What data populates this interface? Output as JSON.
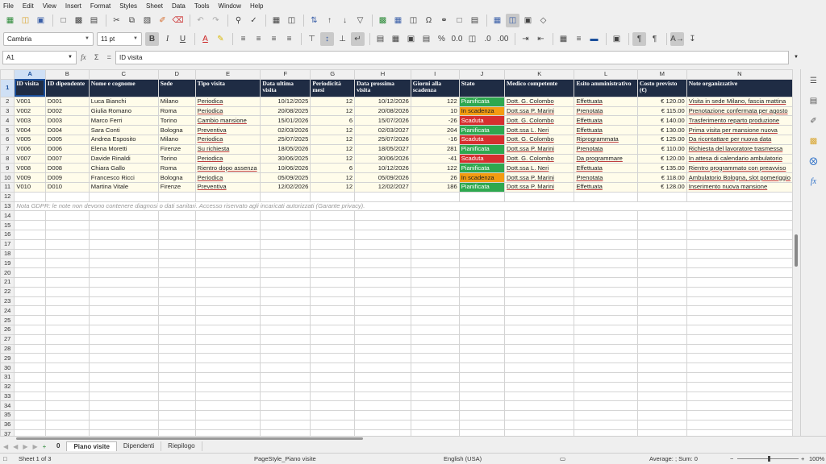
{
  "menu": [
    "File",
    "Edit",
    "View",
    "Insert",
    "Format",
    "Styles",
    "Sheet",
    "Data",
    "Tools",
    "Window",
    "Help"
  ],
  "format": {
    "font_name": "Cambria",
    "font_size": "11 pt"
  },
  "formula": {
    "cell_ref": "A1",
    "content": "ID visita"
  },
  "columns": [
    "A",
    "B",
    "C",
    "D",
    "E",
    "F",
    "G",
    "H",
    "I",
    "J",
    "K",
    "L",
    "M",
    "N"
  ],
  "header": [
    "ID visita",
    "ID dipendente",
    "Nome e cognome",
    "Sede",
    "Tipo visita",
    "Data ultima visita",
    "Periodicità mesi",
    "Data prossima visita",
    "Giorni alla scadenza",
    "Stato",
    "Medico competente",
    "Esito amministrativo",
    "Costo previsto (€)",
    "Note organizzative"
  ],
  "rows": [
    [
      "V001",
      "D001",
      "Luca Bianchi",
      "Milano",
      "Periodica",
      "10/12/2025",
      "12",
      "10/12/2026",
      "122",
      "Pianificata",
      "Dott. G. Colombo",
      "Effettuata",
      "€ 120.00",
      "Visita in sede Milano, fascia mattina"
    ],
    [
      "V002",
      "D002",
      "Giulia Romano",
      "Roma",
      "Periodica",
      "20/08/2025",
      "12",
      "20/08/2026",
      "10",
      "In scadenza",
      "Dott.ssa P. Marini",
      "Prenotata",
      "€ 115.00",
      "Prenotazione confermata per agosto"
    ],
    [
      "V003",
      "D003",
      "Marco Ferri",
      "Torino",
      "Cambio mansione",
      "15/01/2026",
      "6",
      "15/07/2026",
      "-26",
      "Scaduta",
      "Dott. G. Colombo",
      "Effettuata",
      "€ 140.00",
      "Trasferimento reparto produzione"
    ],
    [
      "V004",
      "D004",
      "Sara Conti",
      "Bologna",
      "Preventiva",
      "02/03/2026",
      "12",
      "02/03/2027",
      "204",
      "Pianificata",
      "Dott.ssa L. Neri",
      "Effettuata",
      "€ 130.00",
      "Prima visita per mansione nuova"
    ],
    [
      "V005",
      "D005",
      "Andrea Esposito",
      "Milano",
      "Periodica",
      "25/07/2025",
      "12",
      "25/07/2026",
      "-16",
      "Scaduta",
      "Dott. G. Colombo",
      "Riprogrammata",
      "€ 125.00",
      "Da ricontattare per nuova data"
    ],
    [
      "V006",
      "D006",
      "Elena Moretti",
      "Firenze",
      "Su richiesta",
      "18/05/2026",
      "12",
      "18/05/2027",
      "281",
      "Pianificata",
      "Dott.ssa P. Marini",
      "Prenotata",
      "€ 110.00",
      "Richiesta del lavoratore trasmessa"
    ],
    [
      "V007",
      "D007",
      "Davide Rinaldi",
      "Torino",
      "Periodica",
      "30/06/2025",
      "12",
      "30/06/2026",
      "-41",
      "Scaduta",
      "Dott. G. Colombo",
      "Da programmare",
      "€ 120.00",
      "In attesa di calendario ambulatorio"
    ],
    [
      "V008",
      "D008",
      "Chiara Gallo",
      "Roma",
      "Rientro dopo assenza",
      "10/06/2026",
      "6",
      "10/12/2026",
      "122",
      "Pianificata",
      "Dott.ssa L. Neri",
      "Effettuata",
      "€ 135.00",
      "Rientro programmato con preavviso"
    ],
    [
      "V009",
      "D009",
      "Francesco Ricci",
      "Bologna",
      "Periodica",
      "05/09/2025",
      "12",
      "05/09/2026",
      "26",
      "In scadenza",
      "Dott.ssa P. Marini",
      "Prenotata",
      "€ 118.00",
      "Ambulatorio Bologna, slot pomeriggio"
    ],
    [
      "V010",
      "D010",
      "Martina Vitale",
      "Firenze",
      "Preventiva",
      "12/02/2026",
      "12",
      "12/02/2027",
      "186",
      "Pianificata",
      "Dott.ssa P. Marini",
      "Effettuata",
      "€ 128.00",
      "Inserimento nuova mansione"
    ]
  ],
  "note": "Nota GDPR: le note non devono contenere diagnosi o dati sanitari. Accesso riservato agli incaricati autorizzati (Garante privacy).",
  "status_colors": {
    "Pianificata": "#2ea84f",
    "In scadenza": "#f39c12",
    "Scaduta": "#d62f2f"
  },
  "tabs": [
    "Piano visite",
    "Dipendenti",
    "Riepilogo"
  ],
  "tab_count_label": "0",
  "status": {
    "sheet": "Sheet 1 of 3",
    "page_style": "PageStyle_Piano visite",
    "language": "English (USA)",
    "summary": "Average: ; Sum: 0",
    "zoom": "100%"
  }
}
